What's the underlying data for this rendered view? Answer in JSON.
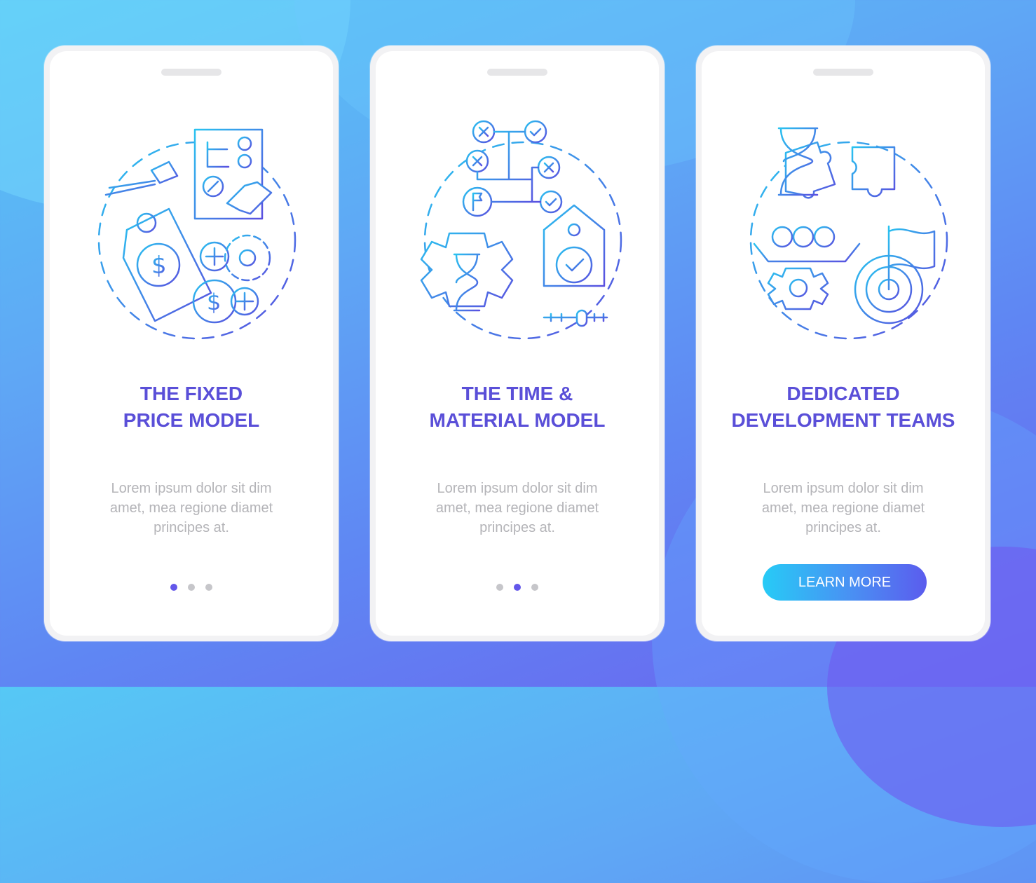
{
  "cards": [
    {
      "title_line1": "THE FIXED",
      "title_line2": "PRICE MODEL",
      "body_line1": "Lorem ipsum dolor sit dim",
      "body_line2": "amet, mea regione diamet",
      "body_line3": "principes at.",
      "illustration": "fixed-price-illustration",
      "active_dot": 1
    },
    {
      "title_line1": "THE TIME &",
      "title_line2": "MATERIAL MODEL",
      "body_line1": "Lorem ipsum dolor sit dim",
      "body_line2": "amet, mea regione diamet",
      "body_line3": "principes at.",
      "illustration": "time-material-illustration",
      "active_dot": 2
    },
    {
      "title_line1": "DEDICATED",
      "title_line2": "DEVELOPMENT TEAMS",
      "body_line1": "Lorem ipsum dolor sit dim",
      "body_line2": "amet, mea regione diamet",
      "body_line3": "principes at.",
      "illustration": "dedicated-teams-illustration",
      "button_label": "LEARN MORE"
    }
  ],
  "colors": {
    "title": "#5a4fd8",
    "body_text": "#b4b4b8",
    "dot_active": "#6357ea",
    "dot_inactive": "#c6c6ca",
    "icon_gradient_start": "#29c3f0",
    "icon_gradient_end": "#5a4fe0"
  }
}
